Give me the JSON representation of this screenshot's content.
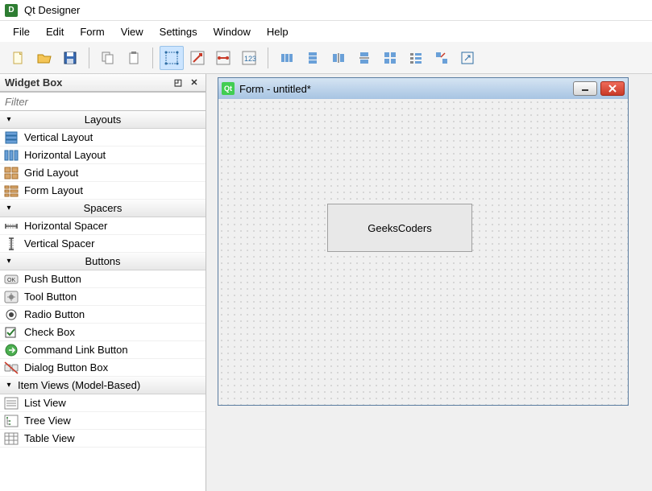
{
  "app": {
    "title": "Qt Designer"
  },
  "menu": [
    "File",
    "Edit",
    "Form",
    "View",
    "Settings",
    "Window",
    "Help"
  ],
  "toolbar": {
    "groups": [
      [
        "new",
        "open",
        "save"
      ],
      [
        "copy",
        "paste"
      ],
      [
        "edit-widgets",
        "edit-signals",
        "edit-buddies",
        "edit-tab-order"
      ],
      [
        "lay-h",
        "lay-v",
        "lay-h-split",
        "lay-v-split",
        "lay-grid",
        "lay-form",
        "break-layout",
        "adjust-size"
      ]
    ],
    "active": "edit-widgets"
  },
  "panel": {
    "title": "Widget Box",
    "filter_placeholder": "Filter",
    "categories": [
      {
        "name": "Layouts",
        "align": "center",
        "items": [
          {
            "label": "Vertical Layout",
            "icon": "vlayout"
          },
          {
            "label": "Horizontal Layout",
            "icon": "hlayout"
          },
          {
            "label": "Grid Layout",
            "icon": "gridlayout"
          },
          {
            "label": "Form Layout",
            "icon": "formlayout"
          }
        ]
      },
      {
        "name": "Spacers",
        "align": "center",
        "items": [
          {
            "label": "Horizontal Spacer",
            "icon": "hspacer"
          },
          {
            "label": "Vertical Spacer",
            "icon": "vspacer"
          }
        ]
      },
      {
        "name": "Buttons",
        "align": "center",
        "items": [
          {
            "label": "Push Button",
            "icon": "pushbutton"
          },
          {
            "label": "Tool Button",
            "icon": "toolbutton"
          },
          {
            "label": "Radio Button",
            "icon": "radiobutton"
          },
          {
            "label": "Check Box",
            "icon": "checkbox"
          },
          {
            "label": "Command Link Button",
            "icon": "commandlink"
          },
          {
            "label": "Dialog Button Box",
            "icon": "dialogbuttonbox"
          }
        ]
      },
      {
        "name": "Item Views (Model-Based)",
        "align": "left",
        "items": [
          {
            "label": "List View",
            "icon": "listview"
          },
          {
            "label": "Tree View",
            "icon": "treeview"
          },
          {
            "label": "Table View",
            "icon": "tableview"
          }
        ]
      }
    ]
  },
  "form": {
    "title": "Form - untitled*",
    "placed_widget_text": "GeeksCoders"
  }
}
